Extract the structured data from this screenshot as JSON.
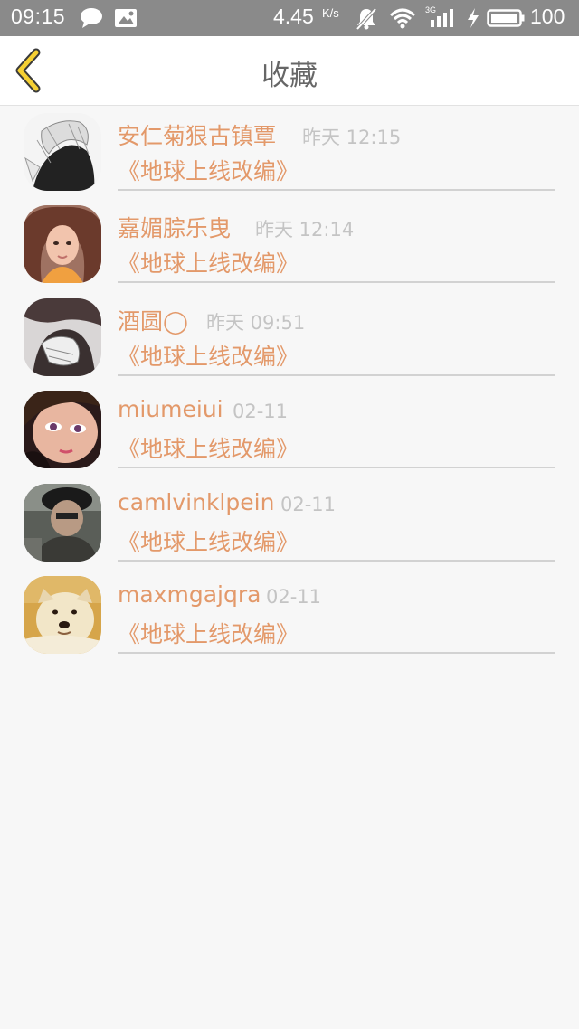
{
  "status_bar": {
    "time": "09:15",
    "speed": "4.45",
    "speed_unit": "K/s",
    "network": "3G",
    "battery": "100",
    "icons": [
      "chat-bubble-icon",
      "image-notification-icon",
      "mute-icon",
      "wifi-icon",
      "signal-icon",
      "charging-icon",
      "battery-icon"
    ]
  },
  "header": {
    "title": "收藏",
    "back_icon": "chevron-left-icon",
    "accent_color": "#f5d033"
  },
  "favorites": [
    {
      "name": "安仁菊狠古镇覃",
      "time": "昨天 12:15",
      "subtitle": "《地球上线改编》",
      "avatar": "sketch-figure"
    },
    {
      "name": "嘉媚腙乐曳",
      "time": "昨天 12:14",
      "subtitle": "《地球上线改编》",
      "avatar": "girl-portrait"
    },
    {
      "name": "酒圆◯",
      "time": "昨天 09:51",
      "subtitle": "《地球上线改编》",
      "avatar": "figure-silhouette"
    },
    {
      "name": "miumeiui",
      "time": "02-11",
      "subtitle": "《地球上线改编》",
      "avatar": "girl-closeup"
    },
    {
      "name": "camlvinklpein",
      "time": "02-11",
      "subtitle": "《地球上线改编》",
      "avatar": "man-with-cap"
    },
    {
      "name": "maxmgajqra",
      "time": "02-11",
      "subtitle": "《地球上线改编》",
      "avatar": "doge-dog"
    }
  ],
  "colors": {
    "name_text": "#e3996a",
    "time_text": "#c4c4c4",
    "status_bar_bg": "#8a8a8a",
    "page_bg": "#f7f7f7"
  }
}
